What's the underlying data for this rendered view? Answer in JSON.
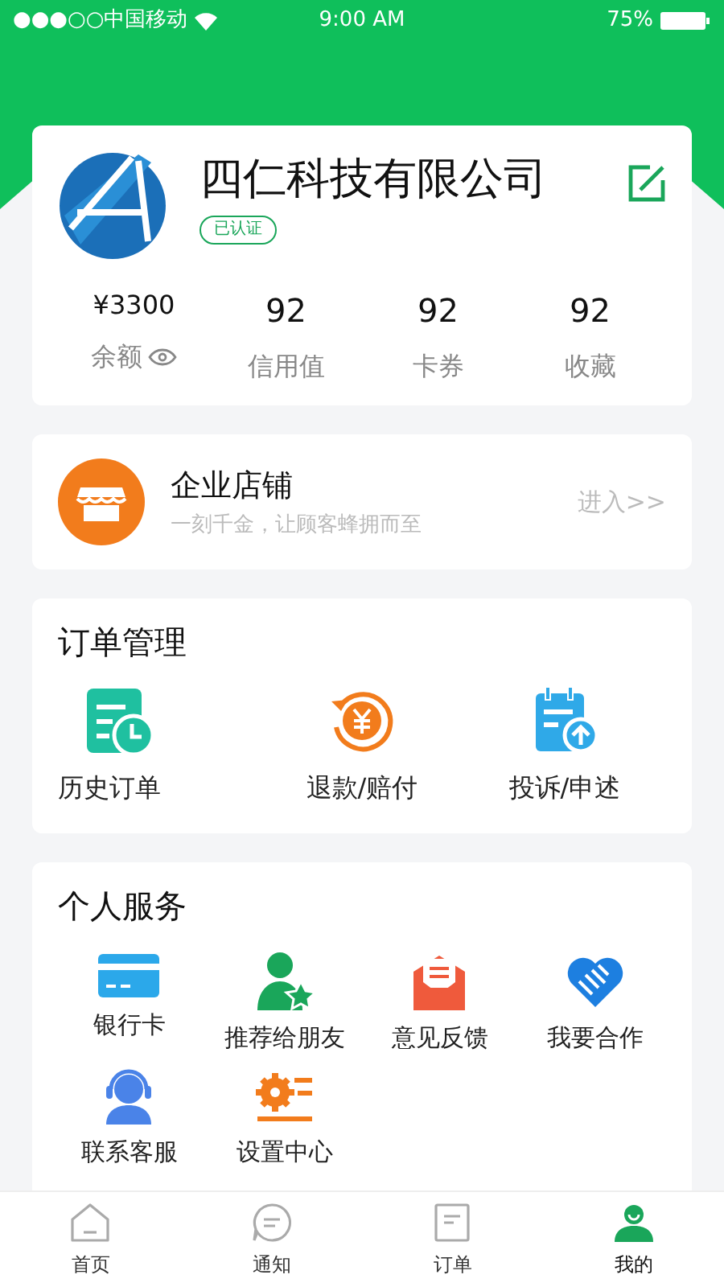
{
  "status_bar": {
    "carrier": "●●●○○中国移动",
    "time": "9:00 AM",
    "battery": "75%"
  },
  "profile": {
    "name": "四仁科技有限公司",
    "badge": "已认证",
    "stats": [
      {
        "value": "¥3300",
        "label": "余额"
      },
      {
        "value": "92",
        "label": "信用值"
      },
      {
        "value": "92",
        "label": "卡券"
      },
      {
        "value": "92",
        "label": "收藏"
      }
    ]
  },
  "store": {
    "title": "企业店铺",
    "subtitle": "一刻千金，让顾客蜂拥而至",
    "link": "进入>>"
  },
  "orders": {
    "title": "订单管理",
    "items": [
      "历史订单",
      "退款/赔付",
      "投诉/申述"
    ]
  },
  "services": {
    "title": "个人服务",
    "items": [
      "银行卡",
      "推荐给朋友",
      "意见反馈",
      "我要合作",
      "联系客服",
      "设置中心"
    ]
  },
  "tabs": [
    {
      "label": "首页",
      "selected": false
    },
    {
      "label": "通知",
      "selected": false
    },
    {
      "label": "订单",
      "selected": false
    },
    {
      "label": "我的",
      "selected": true
    }
  ]
}
